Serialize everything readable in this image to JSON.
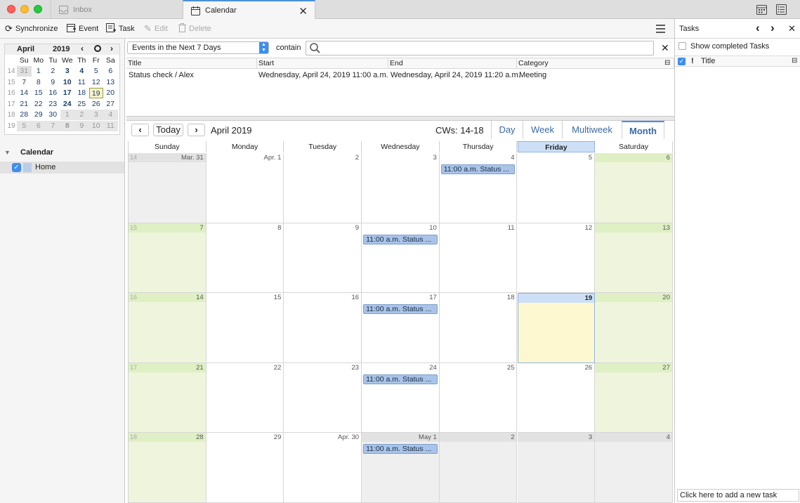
{
  "tabs": [
    {
      "label": "Inbox"
    },
    {
      "label": "Calendar"
    }
  ],
  "toolbar": {
    "synchronize": "Synchronize",
    "event": "Event",
    "task": "Task",
    "edit": "Edit",
    "delete": "Delete"
  },
  "minimonth": {
    "month": "April",
    "year": "2019",
    "dow": [
      "Su",
      "Mo",
      "Tu",
      "We",
      "Th",
      "Fr",
      "Sa"
    ],
    "weeks": [
      {
        "wk": "14",
        "days": [
          "31",
          "1",
          "2",
          "3",
          "4",
          "5",
          "6"
        ]
      },
      {
        "wk": "15",
        "days": [
          "7",
          "8",
          "9",
          "10",
          "11",
          "12",
          "13"
        ]
      },
      {
        "wk": "16",
        "days": [
          "14",
          "15",
          "16",
          "17",
          "18",
          "19",
          "20"
        ]
      },
      {
        "wk": "17",
        "days": [
          "21",
          "22",
          "23",
          "24",
          "25",
          "26",
          "27"
        ]
      },
      {
        "wk": "18",
        "days": [
          "28",
          "29",
          "30",
          "1",
          "2",
          "3",
          "4"
        ]
      },
      {
        "wk": "19",
        "days": [
          "5",
          "6",
          "7",
          "8",
          "9",
          "10",
          "11"
        ]
      }
    ]
  },
  "calendar_list": {
    "header": "Calendar",
    "items": [
      {
        "name": "Home"
      }
    ]
  },
  "filter": {
    "select": "Events in the Next 7 Days",
    "contain": "contain",
    "search_value": ""
  },
  "event_list": {
    "columns": [
      "Title",
      "Start",
      "End",
      "Category"
    ],
    "rows": [
      {
        "title": "Status check / Alex",
        "start": "Wednesday, April 24, 2019 11:00 a.m.",
        "end": "Wednesday, April 24, 2019 11:20 a.m.",
        "category": "Meeting"
      }
    ]
  },
  "nav": {
    "today": "Today",
    "month_label": "April 2019",
    "cws": "CWs: 14-18"
  },
  "views": [
    "Day",
    "Week",
    "Multiweek",
    "Month"
  ],
  "weekdays": [
    "Sunday",
    "Monday",
    "Tuesday",
    "Wednesday",
    "Thursday",
    "Friday",
    "Saturday"
  ],
  "month_grid": [
    {
      "wk": "14",
      "days": [
        "Mar. 31",
        "Apr. 1",
        "2",
        "3",
        "4",
        "5",
        "6"
      ]
    },
    {
      "wk": "15",
      "days": [
        "7",
        "8",
        "9",
        "10",
        "11",
        "12",
        "13"
      ]
    },
    {
      "wk": "16",
      "days": [
        "14",
        "15",
        "16",
        "17",
        "18",
        "19",
        "20"
      ]
    },
    {
      "wk": "17",
      "days": [
        "21",
        "22",
        "23",
        "24",
        "25",
        "26",
        "27"
      ]
    },
    {
      "wk": "18",
      "days": [
        "28",
        "29",
        "Apr. 30",
        "May 1",
        "2",
        "3",
        "4"
      ]
    }
  ],
  "event_label": "11:00 a.m. Status ...",
  "tasks": {
    "title": "Tasks",
    "show_completed": "Show completed Tasks",
    "col_title": "Title",
    "priority": "!",
    "add_task_placeholder": "Click here to add a new task"
  }
}
